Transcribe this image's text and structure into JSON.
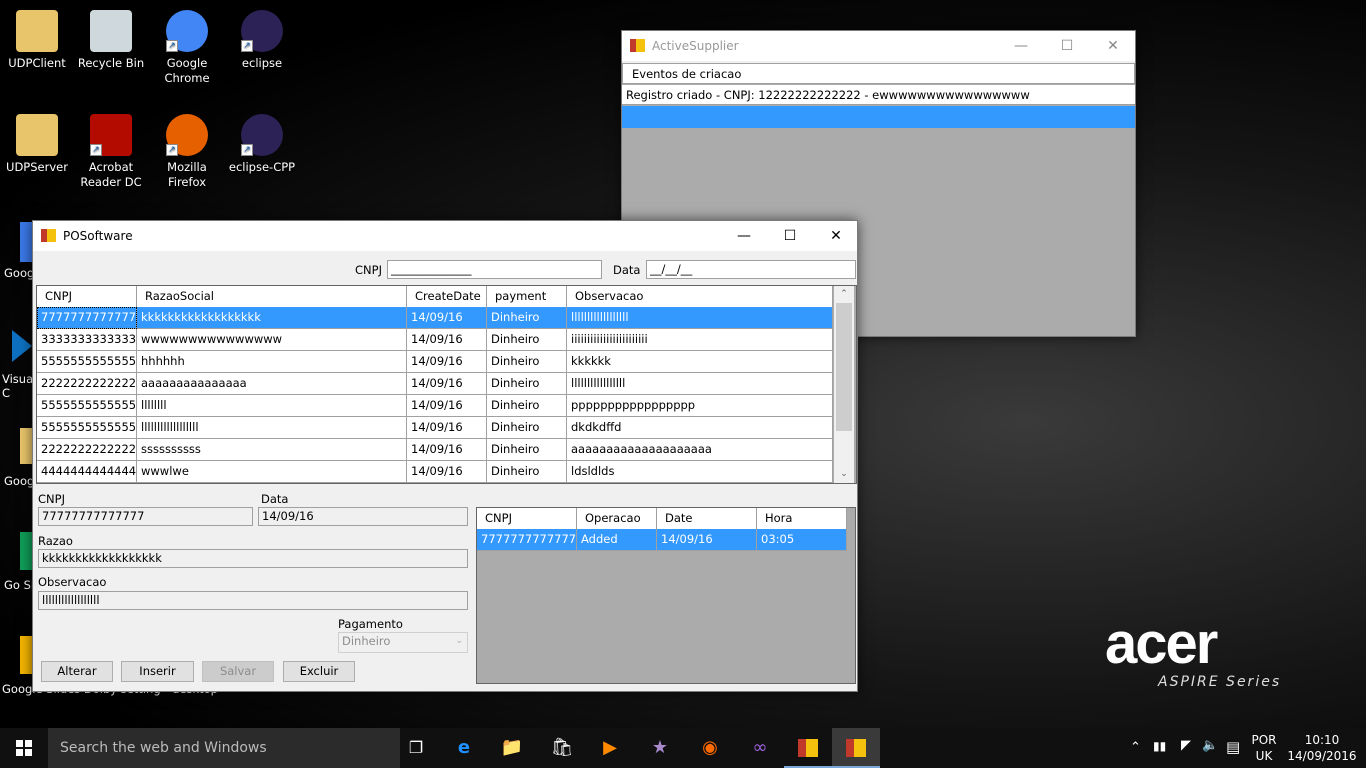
{
  "desktop": {
    "icons": [
      {
        "label": "UDPClient",
        "icon": "folder-icon",
        "color": "#e8c46a"
      },
      {
        "label": "Recycle Bin",
        "icon": "recycle-bin-icon",
        "color": "#cfd8dc"
      },
      {
        "label": "Google Chrome",
        "icon": "chrome-icon",
        "color": "#4285f4"
      },
      {
        "label": "eclipse",
        "icon": "eclipse-icon",
        "color": "#2c2255"
      },
      {
        "label": "UDPServer",
        "icon": "folder-icon",
        "color": "#e8c46a"
      },
      {
        "label": "Acrobat Reader DC",
        "icon": "acrobat-icon",
        "color": "#b30b00"
      },
      {
        "label": "Mozilla Firefox",
        "icon": "firefox-icon",
        "color": "#e66000"
      },
      {
        "label": "eclipse-CPP",
        "icon": "eclipse-icon",
        "color": "#2c2255"
      }
    ],
    "left_partial": [
      "Goog",
      "Visua C",
      "Goog",
      "Go Sh",
      "Google Slides Dolby setting - desktop.ini"
    ],
    "brand": "acer",
    "brand_sub": "ASPIRE Series"
  },
  "active_supplier": {
    "title": "ActiveSupplier",
    "list_header": "Eventos de criacao",
    "items": [
      "Registro criado - CNPJ: 12222222222222 - ewwwwwwwwwwwwwwww"
    ]
  },
  "posoftware": {
    "title": "POSoftware",
    "filter": {
      "cnpj_label": "CNPJ",
      "cnpj_value": "______________",
      "data_label": "Data",
      "data_value": "__/__/__"
    },
    "grid": {
      "columns": [
        "CNPJ",
        "RazaoSocial",
        "CreateDate",
        "payment",
        "Observacao"
      ],
      "rows": [
        [
          "77777777777777",
          "kkkkkkkkkkkkkkkkkk",
          "14/09/16",
          "Dinheiro",
          "llllllllllllllllll"
        ],
        [
          "33333333333333",
          "wwwwwwwwwwwwwww",
          "14/09/16",
          "Dinheiro",
          "iiiiiiiiiiiiiiiiiiiiiiii"
        ],
        [
          "55555555555555",
          "hhhhhh",
          "14/09/16",
          "Dinheiro",
          "kkkkkk"
        ],
        [
          "22222222222222",
          "aaaaaaaaaaaaaaa",
          "14/09/16",
          "Dinheiro",
          "lllllllllllllllll"
        ],
        [
          "55555555555555",
          "llllllll",
          "14/09/16",
          "Dinheiro",
          "ppppppppppppppppp"
        ],
        [
          "55555555555555",
          "llllllllllllllllll",
          "14/09/16",
          "Dinheiro",
          "dkdkdffd"
        ],
        [
          "22222222222222",
          "ssssssssss",
          "14/09/16",
          "Dinheiro",
          "aaaaaaaaaaaaaaaaaaaa"
        ],
        [
          "44444444444444",
          "wwwlwe",
          "14/09/16",
          "Dinheiro",
          "ldsldlds"
        ]
      ]
    },
    "form": {
      "cnpj_label": "CNPJ",
      "cnpj": "77777777777777",
      "data_label": "Data",
      "data": "14/09/16",
      "razao_label": "Razao",
      "razao": "kkkkkkkkkkkkkkkkkk",
      "obs_label": "Observacao",
      "obs": "llllllllllllllllll",
      "pagamento_label": "Pagamento",
      "pagamento": "Dinheiro"
    },
    "buttons": {
      "alterar": "Alterar",
      "inserir": "Inserir",
      "salvar": "Salvar",
      "excluir": "Excluir"
    },
    "log": {
      "columns": [
        "CNPJ",
        "Operacao",
        "Date",
        "Hora"
      ],
      "rows": [
        [
          "77777777777777",
          "Added",
          "14/09/16",
          "03:05"
        ]
      ]
    }
  },
  "taskbar": {
    "search_placeholder": "Search the web and Windows",
    "lang": "POR",
    "region": "UK",
    "time": "10:10",
    "date": "14/09/2016"
  },
  "colors": {
    "selection": "#3399ff",
    "taskbar": "#101010"
  }
}
